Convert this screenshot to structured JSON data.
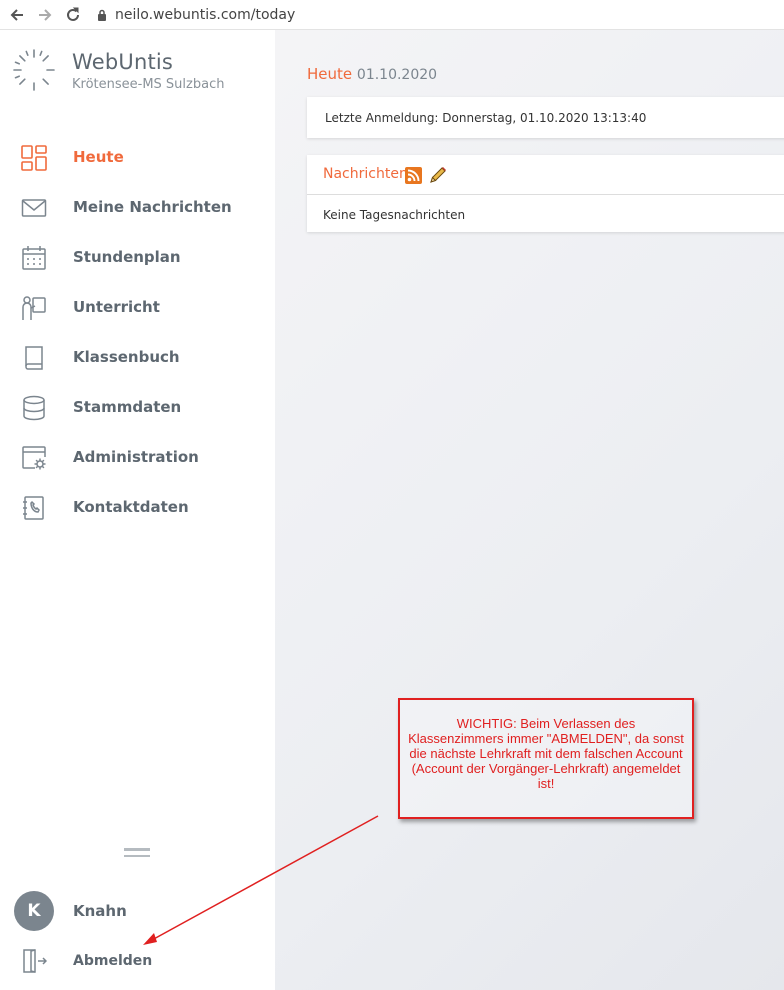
{
  "browser": {
    "url": "neilo.webuntis.com/today",
    "icons": [
      "back-arrow-icon",
      "forward-arrow-icon",
      "reload-icon",
      "lock-icon"
    ]
  },
  "sidebar": {
    "brand": "WebUntis",
    "school": "Krötensee-MS Sulzbach",
    "items": [
      {
        "label": "Heute",
        "icon": "dashboard-icon",
        "active": true
      },
      {
        "label": "Meine Nachrichten",
        "icon": "mail-icon"
      },
      {
        "label": "Stundenplan",
        "icon": "calendar-icon"
      },
      {
        "label": "Unterricht",
        "icon": "teacher-board-icon"
      },
      {
        "label": "Klassenbuch",
        "icon": "book-icon"
      },
      {
        "label": "Stammdaten",
        "icon": "database-icon"
      },
      {
        "label": "Administration",
        "icon": "settings-window-icon"
      },
      {
        "label": "Kontaktdaten",
        "icon": "phone-book-icon"
      }
    ],
    "user": {
      "initial": "K",
      "name": "Knahn"
    },
    "logout_label": "Abmelden"
  },
  "main": {
    "title": "Heute",
    "date": "01.10.2020",
    "last_login": "Letzte Anmeldung: Donnerstag, 01.10.2020 13:13:40",
    "news_title": "Nachrichten",
    "news_empty": "Keine Tagesnachrichten"
  },
  "annotation": {
    "text": "WICHTIG: Beim Verlassen des Klassenzimmers immer \"ABMELDEN\", da sonst die nächste Lehrkraft mit dem falschen Account (Account der Vorgänger-Lehrkraft) angemeldet ist!"
  },
  "colors": {
    "accent": "#f06a3c",
    "text": "#5d6770",
    "annotation": "#e02020"
  }
}
